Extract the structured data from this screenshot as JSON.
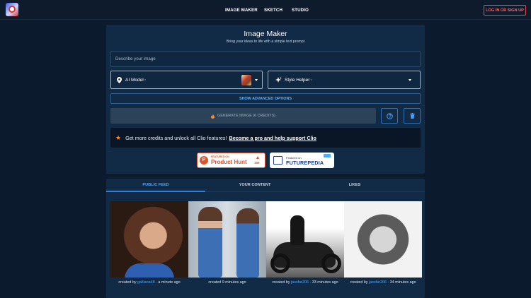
{
  "nav": {
    "items": [
      "IMAGE MAKER",
      "SKETCH",
      "STUDIO"
    ],
    "login": "LOG IN OR SIGN UP"
  },
  "maker": {
    "title": "Image Maker",
    "subtitle": "Bring your ideas to life with a simple text prompt",
    "prompt_placeholder": "Describe your image",
    "model_label": "AI Model",
    "style_label": "Style Helper",
    "help_mark": "?",
    "advanced": "SHOW ADVANCED OPTIONS",
    "generate": "GENERATE IMAGE (6 CREDITS)"
  },
  "promo": {
    "text": "Get more credits and unlock all Clio features!",
    "link": "Become a pro and help support Clio"
  },
  "badges": {
    "ph_top": "FEATURED ON",
    "ph_name": "Product Hunt",
    "ph_count": "159",
    "fp_top": "Featured on",
    "fp_name": "FUTUREPEDIA"
  },
  "tabs": [
    "PUBLIC FEED",
    "YOUR CONTENT",
    "LIKES"
  ],
  "feed": [
    {
      "prefix": "created by ",
      "user": "galliana48",
      "time": " · a minute ago"
    },
    {
      "prefix": "created 9 minutes ago",
      "user": "",
      "time": ""
    },
    {
      "prefix": "created by ",
      "user": "jassfar206",
      "time": " · 33 minutes ago"
    },
    {
      "prefix": "created by ",
      "user": "jassfar206",
      "time": " · 34 minutes ago"
    }
  ],
  "colors": {
    "accent": "#2f7fd8",
    "link": "#4da3ff",
    "login": "#e24b4b",
    "panel": "#112b47",
    "page": "#0b1a2c"
  }
}
